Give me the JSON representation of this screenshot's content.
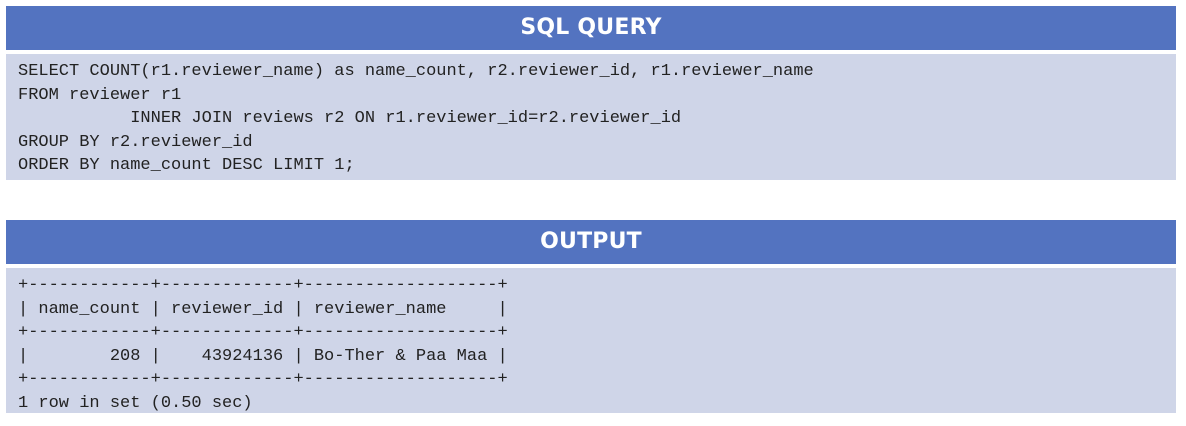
{
  "sql_section": {
    "title": "SQL QUERY",
    "lines": [
      "SELECT COUNT(r1.reviewer_name) as name_count, r2.reviewer_id, r1.reviewer_name",
      "FROM reviewer r1",
      "           INNER JOIN reviews r2 ON r1.reviewer_id=r2.reviewer_id",
      "GROUP BY r2.reviewer_id",
      "ORDER BY name_count DESC LIMIT 1;"
    ]
  },
  "output_section": {
    "title": "OUTPUT",
    "lines": [
      "+------------+-------------+-------------------+",
      "| name_count | reviewer_id | reviewer_name     |",
      "+------------+-------------+-------------------+",
      "|        208 |    43924136 | Bo-Ther & Paa Maa |",
      "+------------+-------------+-------------------+",
      "1 row in set (0.50 sec)"
    ]
  }
}
